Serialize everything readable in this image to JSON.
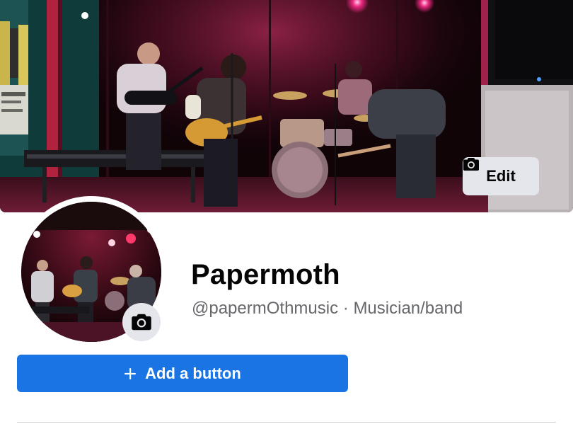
{
  "cover": {
    "edit_label": "Edit",
    "edit_icon": "camera-icon"
  },
  "profile": {
    "name": "Papermoth",
    "handle": "@papermOthmusic",
    "separator": "·",
    "category": "Musician/band",
    "avatar_camera_icon": "camera-icon"
  },
  "actions": {
    "add_button_label": "Add a button",
    "add_button_icon": "plus-icon",
    "add_button_color": "#1b74e4"
  },
  "colors": {
    "secondary_button_bg": "#e4e6eb",
    "text_primary": "#050505",
    "text_secondary": "#65676b"
  }
}
